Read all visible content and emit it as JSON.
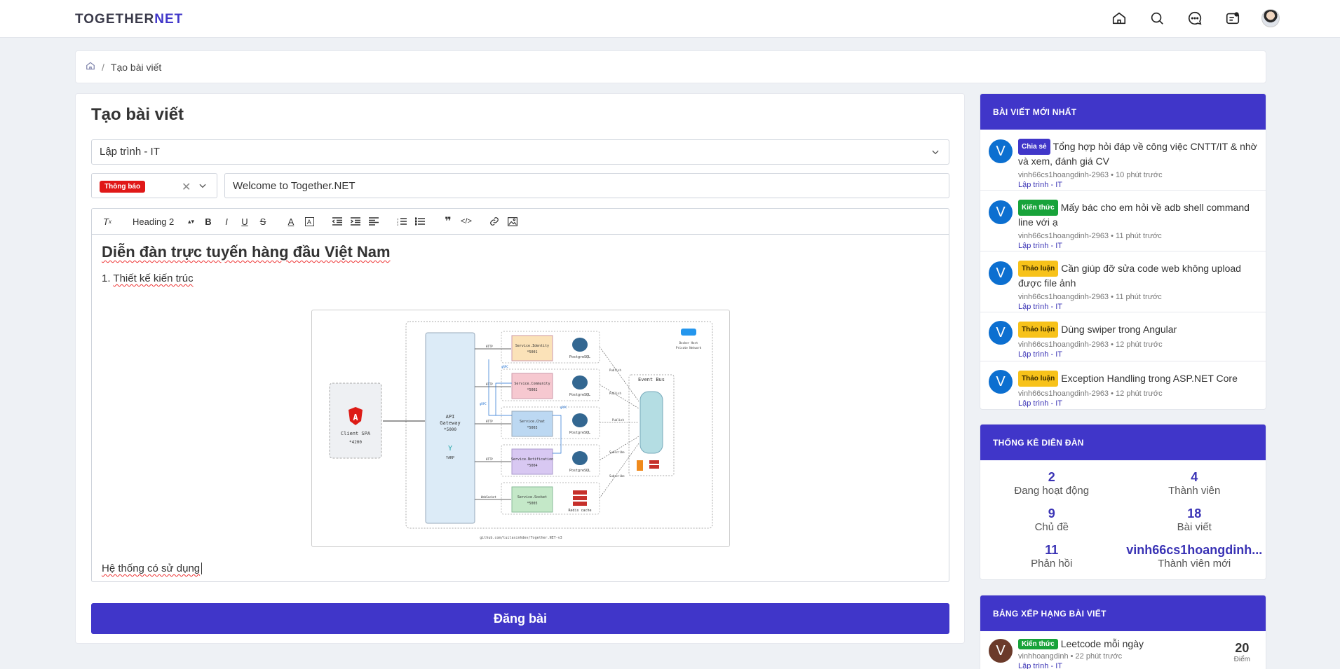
{
  "header": {
    "logo_main": "TOGETHER",
    "logo_accent": "NET",
    "icons": [
      "home-icon",
      "search-icon",
      "chat-icon",
      "news-icon",
      "user-avatar"
    ]
  },
  "breadcrumb": {
    "current": "Tạo bài viết"
  },
  "form": {
    "page_title": "Tạo bài viết",
    "category_value": "Lập trình - IT",
    "tag_value": "Thông báo",
    "title_value": "Welcome to Together.NET",
    "toolbar": {
      "heading_select": "Heading 2"
    },
    "content": {
      "heading": "Diễn đàn trực tuyến hàng đầu Việt Nam",
      "list_item_prefix": "1. ",
      "list_item_text": "Thiết kế kiến trúc",
      "last_line": "Hệ thống có sử dụng"
    },
    "diagram": {
      "client": "Client SPA",
      "client_port": "*4200",
      "gateway_1": "API",
      "gateway_2": "Gateway",
      "gateway_port": "*5000",
      "yarp": "YARP",
      "svc_identity": "Service.Identity",
      "svc_identity_port": "*5001",
      "svc_community": "Service.Community",
      "svc_community_port": "*5002",
      "svc_chat": "Service.Chat",
      "svc_chat_port": "*5003",
      "svc_notification": "Service.Notification",
      "svc_notification_port": "*5004",
      "svc_socket": "Service.Socket",
      "svc_socket_port": "*5005",
      "postgres": "PostgreSQL",
      "redis": "Redis cache",
      "event_bus": "Event Bus",
      "docker_1": "Docker Host",
      "docker_2": "Private Network",
      "publish": "Publish",
      "subscribe": "Subscribe",
      "http": "HTTP",
      "grpc": "gRPC",
      "websocket": "WebSocket",
      "footer": "github.com/tuilaxinhdev/Together.NET-v3"
    },
    "submit_label": "Đăng bài"
  },
  "latest_posts": {
    "heading": "BÀI VIẾT MỚI NHẤT",
    "items": [
      {
        "avatar": "V",
        "badge": "Chia sẻ",
        "badge_color": "#4036c9",
        "badge_text_color": "#ffffff",
        "title": "Tổng hợp hỏi đáp về công việc CNTT/IT & nhờ và xem, đánh giá CV",
        "author": "vinh66cs1hoangdinh-2963",
        "time": "10 phút trước",
        "category": "Lập trình - IT"
      },
      {
        "avatar": "V",
        "badge": "Kiến thức",
        "badge_color": "#18a33a",
        "badge_text_color": "#ffffff",
        "title": "Mấy bác cho em hỏi về adb shell command line với ạ",
        "author": "vinh66cs1hoangdinh-2963",
        "time": "11 phút trước",
        "category": "Lập trình - IT"
      },
      {
        "avatar": "V",
        "badge": "Thảo luận",
        "badge_color": "#f7c21a",
        "badge_text_color": "#3a2a00",
        "title": "Cần giúp đỡ sửa code web không upload được file ảnh",
        "author": "vinh66cs1hoangdinh-2963",
        "time": "11 phút trước",
        "category": "Lập trình - IT"
      },
      {
        "avatar": "V",
        "badge": "Thảo luận",
        "badge_color": "#f7c21a",
        "badge_text_color": "#3a2a00",
        "title": "Dùng swiper trong Angular",
        "author": "vinh66cs1hoangdinh-2963",
        "time": "12 phút trước",
        "category": "Lập trình - IT"
      },
      {
        "avatar": "V",
        "badge": "Thảo luận",
        "badge_color": "#f7c21a",
        "badge_text_color": "#3a2a00",
        "title": "Exception Handling trong ASP.NET Core",
        "author": "vinh66cs1hoangdinh-2963",
        "time": "12 phút trước",
        "category": "Lập trình - IT"
      }
    ]
  },
  "forum_stats": {
    "heading": "THỐNG KÊ DIỄN ĐÀN",
    "items": [
      {
        "value": "2",
        "label": "Đang hoạt động"
      },
      {
        "value": "4",
        "label": "Thành viên"
      },
      {
        "value": "9",
        "label": "Chủ đề"
      },
      {
        "value": "18",
        "label": "Bài viết"
      },
      {
        "value": "11",
        "label": "Phản hồi"
      },
      {
        "value": "vinh66cs1hoangdinh...",
        "label": "Thành viên mới"
      }
    ]
  },
  "ranking": {
    "heading": "BẢNG XẾP HẠNG BÀI VIẾT",
    "items": [
      {
        "avatar": "V",
        "badge": "Kiến thức",
        "title": "Leetcode mỗi ngày",
        "author": "vinhhoangdinh",
        "time": "22 phút trước",
        "category": "Lập trình - IT",
        "score": "20",
        "score_unit": "Điểm"
      }
    ]
  },
  "colors": {
    "primary": "#4036c9",
    "danger": "#e01818"
  }
}
